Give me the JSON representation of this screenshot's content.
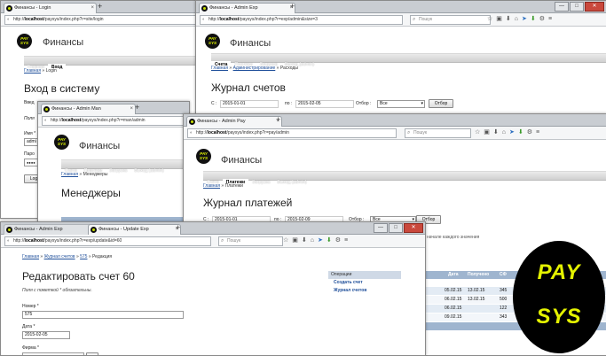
{
  "brand": {
    "pay": "PAY",
    "sys": "SYS",
    "pay_small": "PAY",
    "sys_small": "SYS"
  },
  "site_name": "Финансы",
  "w1": {
    "tab": "Финансы - Login",
    "url_prefix": "http://",
    "url_host": "localhost",
    "url_path": "/paysys/index.php?r=site/login",
    "menu": [
      "Главная",
      "Вход"
    ],
    "crumb_home": "Главная",
    "crumb_sep": " » ",
    "crumb_current": "Login",
    "title": "Вход в систему",
    "frag1": "Введ",
    "frag2": "Поля",
    "frag3": "Имя *",
    "frag4": "admi",
    "frag5": "Паро",
    "frag6": "●●●●",
    "frag7": "Log"
  },
  "w2": {
    "tab": "Финансы - Admin Exp",
    "url_prefix": "http://",
    "url_host": "localhost",
    "url_path": "/paysys/index.php?r=exp/admin&size=3",
    "search": "Пошук",
    "menu": [
      "Счета",
      "Платежи",
      "Загрузка",
      "Выход (admin)"
    ],
    "crumb_home": "Главная",
    "crumb_mid": "Администрирование",
    "crumb_current": "Расходы",
    "title": "Журнал счетов",
    "from_label": "С :",
    "from_value": "2015-01-01",
    "to_label": "по :",
    "to_value": "2015-02-05",
    "filter_label": "Отбор :",
    "filter_value": "Все",
    "filter_button": "Отбор"
  },
  "w3": {
    "tab": "Финансы - Admin Man",
    "url_prefix": "http://",
    "url_host": "localhost",
    "url_path": "/paysys/index.php?r=man/admin",
    "menu": [
      "Счета",
      "Платежи",
      "Загрузка",
      "Выход (admin)"
    ],
    "crumb_home": "Главная",
    "crumb_current": "Менеджеры",
    "title": "Менеджеры"
  },
  "w4": {
    "tab": "Финансы - Admin Pay",
    "url_prefix": "http://",
    "url_host": "localhost",
    "url_path": "/paysys/index.php?r=pay/admin",
    "search": "Пошук",
    "menu": [
      "Счета",
      "Платежи",
      "Загрузка",
      "Выход (admin)"
    ],
    "crumb_home": "Главная",
    "crumb_current": "Платежи",
    "title": "Журнал платежей",
    "from_label": "С :",
    "from_value": "2015-01-01",
    "to_label": "по :",
    "to_value": "2015-02-09",
    "filter_label": "Отбор :",
    "filter_value": "Все",
    "filter_button": "Отбор",
    "note": "начале каждого значения",
    "columns": [
      "Дата",
      "Получено",
      "СФ"
    ],
    "rows": [
      [
        "05.02.15",
        "13.02.15",
        "345"
      ],
      [
        "06.02.15",
        "13.02.15",
        "500"
      ],
      [
        "06.02.15",
        "",
        "122"
      ],
      [
        "09.02.15",
        "",
        "343"
      ]
    ]
  },
  "w5": {
    "tab1": "Финансы - Admin Exp",
    "tab2": "Финансы - Update Exp",
    "url_prefix": "http://",
    "url_host": "localhost",
    "url_path": "/paysys/index.php?r=exp/update&id=60",
    "search": "Пошук",
    "crumb_home": "Главная",
    "crumb_mid": "Журнал счетов",
    "crumb_id": "575",
    "crumb_current": "Редакция",
    "title": "Редактировать счет 60",
    "hint": "Поля с пометкой * обязательны.",
    "number_label": "Номер *",
    "number_value": "575",
    "date_label": "Дата *",
    "date_value": "2015-02-05",
    "firm_label": "Фирма *",
    "side_title": "Операции",
    "side_links": [
      "Создать счет",
      "Журнал счетов"
    ]
  }
}
